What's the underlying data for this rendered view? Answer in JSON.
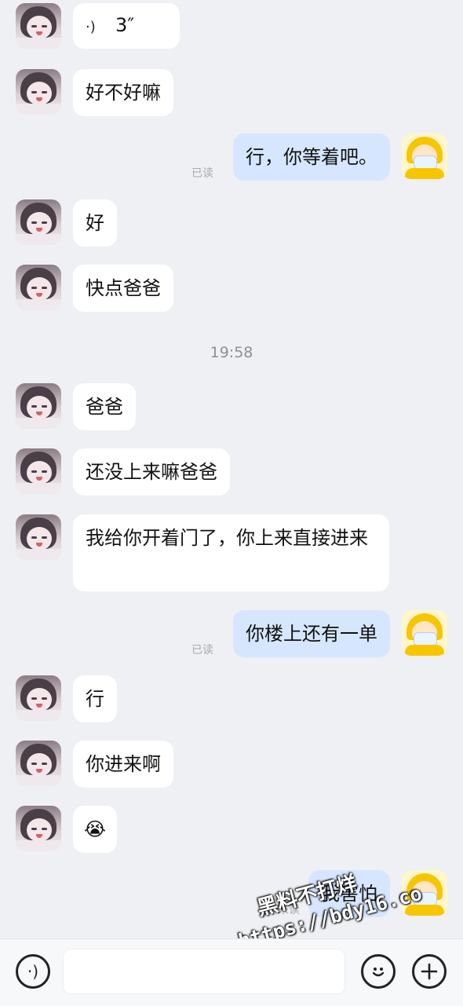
{
  "messages": [
    {
      "text": "3″"
    },
    {
      "text": "好不好嘛"
    },
    {
      "text": "行，你等着吧。",
      "status": "已读"
    },
    {
      "text": "好"
    },
    {
      "text": "快点爸爸"
    },
    {
      "text": "爸爸"
    },
    {
      "text": "还没上来嘛爸爸"
    },
    {
      "text": "我给你开着门了，你上来直接进来"
    },
    {
      "text": "你楼上还有一单",
      "status": "已读"
    },
    {
      "text": "行"
    },
    {
      "text": "你进来啊"
    },
    {
      "text": "😭"
    },
    {
      "text": "我害怕",
      "status": "未读"
    }
  ],
  "timestamp": "19:58",
  "watermark": {
    "line1": "黑料不打烊",
    "line2": "https://bdy16.co"
  },
  "toolbar": {
    "voice_icon": "voice-icon",
    "emoji_icon": "emoji-icon",
    "plus_icon": "plus-icon"
  }
}
